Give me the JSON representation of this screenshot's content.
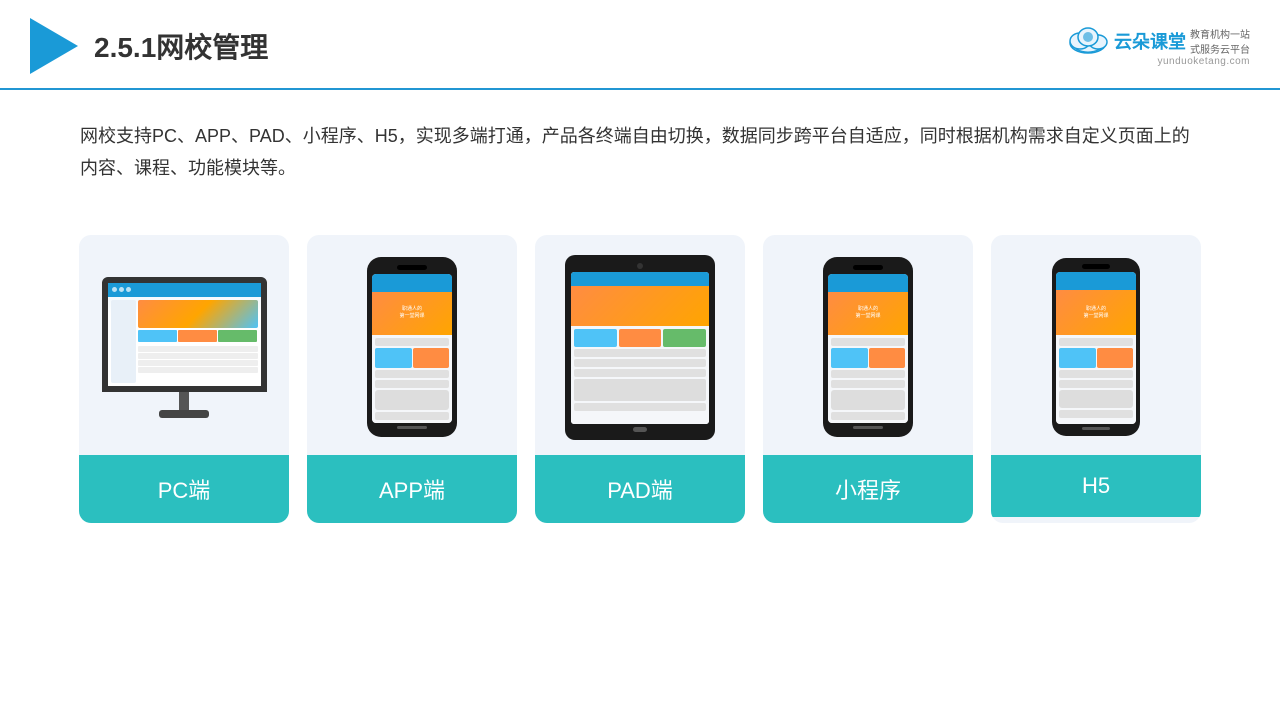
{
  "header": {
    "title": "2.5.1网校管理",
    "brand": {
      "name": "云朵课堂",
      "url": "yunduoketang.com",
      "tagline1": "教育机构一站",
      "tagline2": "式服务云平台"
    }
  },
  "description": {
    "text": "网校支持PC、APP、PAD、小程序、H5，实现多端打通，产品各终端自由切换，数据同步跨平台自适应，同时根据机构需求自定义页面上的内容、课程、功能模块等。"
  },
  "cards": [
    {
      "id": "pc",
      "label": "PC端"
    },
    {
      "id": "app",
      "label": "APP端"
    },
    {
      "id": "pad",
      "label": "PAD端"
    },
    {
      "id": "miniprogram",
      "label": "小程序"
    },
    {
      "id": "h5",
      "label": "H5"
    }
  ]
}
